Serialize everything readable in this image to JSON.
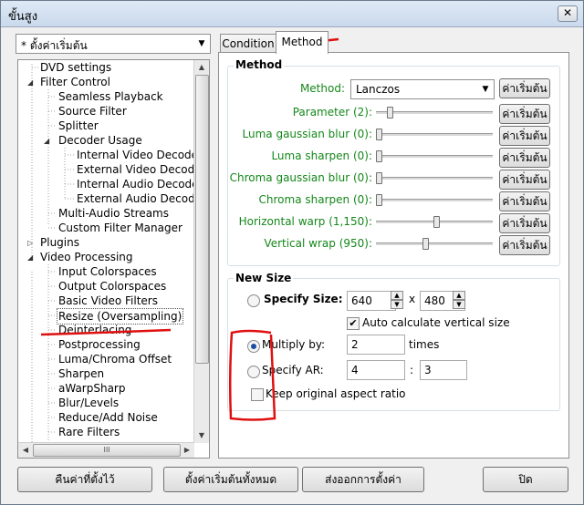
{
  "window": {
    "title": "ขั้นสูง",
    "close_icon": "✕"
  },
  "preset": {
    "value": "* ตั้งค่าเริ่มต้น"
  },
  "tree": {
    "items": [
      {
        "label": "DVD settings"
      },
      {
        "label": "Filter Control"
      },
      {
        "label": "Seamless Playback"
      },
      {
        "label": "Source Filter"
      },
      {
        "label": "Splitter"
      },
      {
        "label": "Decoder Usage"
      },
      {
        "label": "Internal Video Decoder"
      },
      {
        "label": "External Video Decoder"
      },
      {
        "label": "Internal Audio Decoder"
      },
      {
        "label": "External Audio Decoder"
      },
      {
        "label": "Multi-Audio Streams"
      },
      {
        "label": "Custom Filter Manager"
      },
      {
        "label": "Plugins"
      },
      {
        "label": "Video Processing"
      },
      {
        "label": "Input Colorspaces"
      },
      {
        "label": "Output Colorspaces"
      },
      {
        "label": "Basic Video Filters"
      },
      {
        "label": "Resize (Oversampling)"
      },
      {
        "label": "Deinterlacing"
      },
      {
        "label": "Postprocessing"
      },
      {
        "label": "Luma/Chroma Offset"
      },
      {
        "label": "Sharpen"
      },
      {
        "label": "aWarpSharp"
      },
      {
        "label": "Blur/Levels"
      },
      {
        "label": "Reduce/Add Noise"
      },
      {
        "label": "Rare Filters"
      }
    ],
    "scroll_grip": "III"
  },
  "tabs": [
    {
      "label": "Condition"
    },
    {
      "label": "Method"
    }
  ],
  "method": {
    "group_title": "Method",
    "method_label": "Method:",
    "method_value": "Lanczos",
    "default_label": "ค่าเริ่มต้น",
    "rows": [
      {
        "label": "Parameter (2):",
        "value": 0.1
      },
      {
        "label": "Luma gaussian blur (0):",
        "value": 0.0
      },
      {
        "label": "Luma sharpen (0):",
        "value": 0.0
      },
      {
        "label": "Chroma gaussian blur (0):",
        "value": 0.0
      },
      {
        "label": "Chroma sharpen (0):",
        "value": 0.0
      },
      {
        "label": "Horizontal warp (1,150):",
        "value": 0.52
      },
      {
        "label": "Vertical wrap (950):",
        "value": 0.42
      }
    ]
  },
  "new_size": {
    "group_title": "New Size",
    "specify_size_label": "Specify Size:",
    "width": "640",
    "x_sep": "x",
    "height": "480",
    "auto_calc_label": "Auto calculate vertical size",
    "multiply_label": "Multiply by:",
    "multiply_value": "2",
    "times_label": "times",
    "specify_ar_label": "Specify AR:",
    "ar_w": "4",
    "ar_sep": ":",
    "ar_h": "3",
    "keep_aspect_label": "Keep original aspect ratio"
  },
  "footer": {
    "restore": "คืนค่าที่ตั้งไว้",
    "reset_all": "ตั้งค่าเริ่มต้นทั้งหมด",
    "export": "ส่งออกการตั้งค่า",
    "close": "ปิด"
  },
  "colors": {
    "annotation": "#e01010",
    "label_green": "#14871a"
  }
}
